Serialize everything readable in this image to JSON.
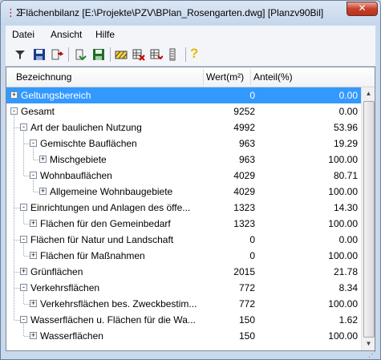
{
  "window": {
    "title": "Flächenbilanz [E:\\Projekte\\PZV\\BPlan_Rosengarten.dwg] [Planzv90Bil]",
    "close_label": "✕"
  },
  "menu": {
    "items": [
      "Datei",
      "Ansicht",
      "Hilfe"
    ]
  },
  "toolbar": {
    "icons": [
      "filter-icon",
      "save-icon",
      "export-icon",
      "import-icon",
      "save-green-icon",
      "hatch-icon",
      "table-export-icon",
      "list-icon",
      "help-icon"
    ]
  },
  "table": {
    "columns": [
      "Bezeichnung",
      "Wert(m²)",
      "Anteil(%)"
    ],
    "rows": [
      {
        "label": "Geltungsbereich",
        "value": "0",
        "share": "0.00",
        "selected": true
      },
      {
        "label": "Gesamt",
        "value": "9252",
        "share": "0.00"
      },
      {
        "label": "Art der baulichen Nutzung",
        "value": "4992",
        "share": "53.96"
      },
      {
        "label": "Gemischte Bauflächen",
        "value": "963",
        "share": "19.29"
      },
      {
        "label": "Mischgebiete",
        "value": "963",
        "share": "100.00"
      },
      {
        "label": "Wohnbauflächen",
        "value": "4029",
        "share": "80.71"
      },
      {
        "label": "Allgemeine Wohnbaugebiete",
        "value": "4029",
        "share": "100.00"
      },
      {
        "label": "Einrichtungen und Anlagen des öffe...",
        "value": "1323",
        "share": "14.30"
      },
      {
        "label": "Flächen für den Gemeinbedarf",
        "value": "1323",
        "share": "100.00"
      },
      {
        "label": "Flächen für Natur und Landschaft",
        "value": "0",
        "share": "0.00"
      },
      {
        "label": "Flächen für Maßnahmen",
        "value": "0",
        "share": "100.00"
      },
      {
        "label": "Grünflächen",
        "value": "2015",
        "share": "21.78"
      },
      {
        "label": "Verkehrsflächen",
        "value": "772",
        "share": "8.34"
      },
      {
        "label": "Verkehrsflächen bes. Zweckbestim...",
        "value": "772",
        "share": "100.00"
      },
      {
        "label": "Wasserflächen u. Flächen für die Wa...",
        "value": "150",
        "share": "1.62"
      },
      {
        "label": "Wasserflächen",
        "value": "150",
        "share": "100.00"
      }
    ]
  }
}
